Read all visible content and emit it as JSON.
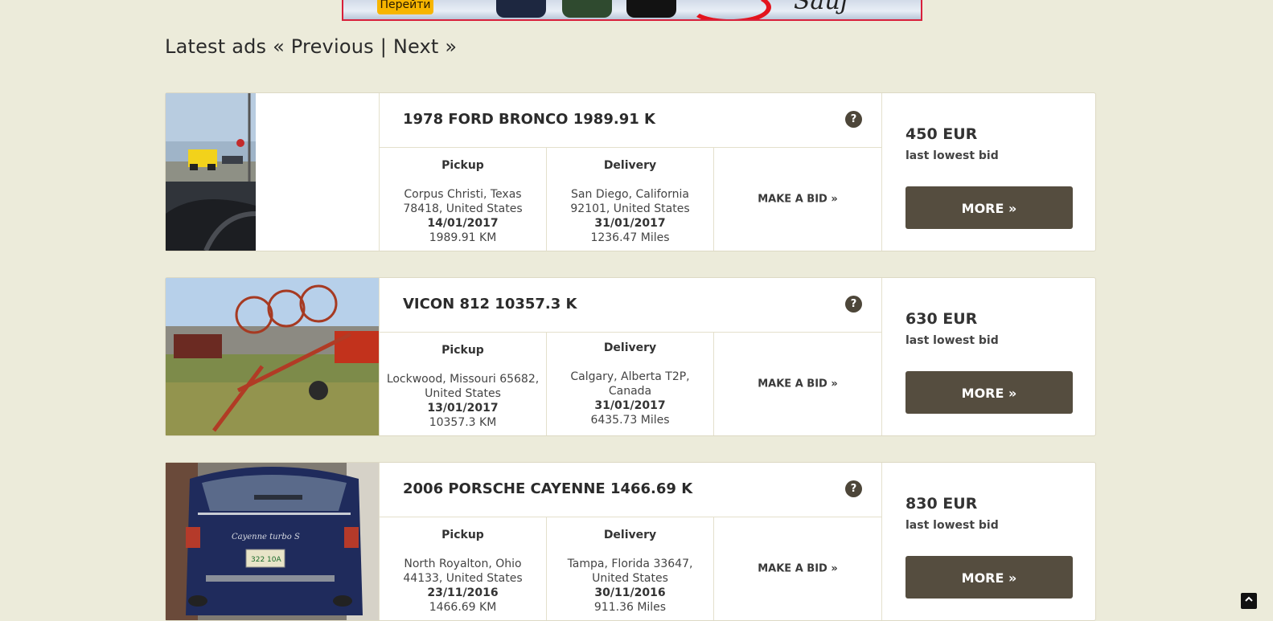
{
  "banner": {
    "button_label": "Перейти"
  },
  "heading": {
    "title": "Latest ads",
    "prev": "« Previous",
    "separator": "|",
    "next": "Next »"
  },
  "ads": [
    {
      "title": "1978 FORD BRONCO 1989.91 K",
      "pickup": {
        "label": "Pickup",
        "location": "Corpus Christi, Texas 78418, United States",
        "date": "14/01/2017",
        "distance": "1989.91 KM"
      },
      "delivery": {
        "label": "Delivery",
        "location": "San Diego, California 92101, United States",
        "date": "31/01/2017",
        "distance": "1236.47 Miles"
      },
      "bid_label": "MAKE A BID »",
      "price": "450 EUR",
      "price_sub": "last lowest bid",
      "more_label": "MORE »"
    },
    {
      "title": "VICON 812 10357.3 K",
      "pickup": {
        "label": "Pickup",
        "location": "Lockwood, Missouri 65682, United States",
        "date": "13/01/2017",
        "distance": "10357.3 KM"
      },
      "delivery": {
        "label": "Delivery",
        "location": "Calgary, Alberta T2P, Canada",
        "date": "31/01/2017",
        "distance": "6435.73 Miles"
      },
      "bid_label": "MAKE A BID »",
      "price": "630 EUR",
      "price_sub": "last lowest bid",
      "more_label": "MORE »"
    },
    {
      "title": "2006 PORSCHE CAYENNE 1466.69 K",
      "pickup": {
        "label": "Pickup",
        "location": "North Royalton, Ohio 44133, United States",
        "date": "23/11/2016",
        "distance": "1466.69 KM"
      },
      "delivery": {
        "label": "Delivery",
        "location": "Tampa, Florida 33647, United States",
        "date": "30/11/2016",
        "distance": "911.36 Miles"
      },
      "bid_label": "MAKE A BID »",
      "price": "830 EUR",
      "price_sub": "last lowest bid",
      "more_label": "MORE »"
    }
  ],
  "help_icon": "?",
  "scroll_top_icon": "chevron-up-icon"
}
